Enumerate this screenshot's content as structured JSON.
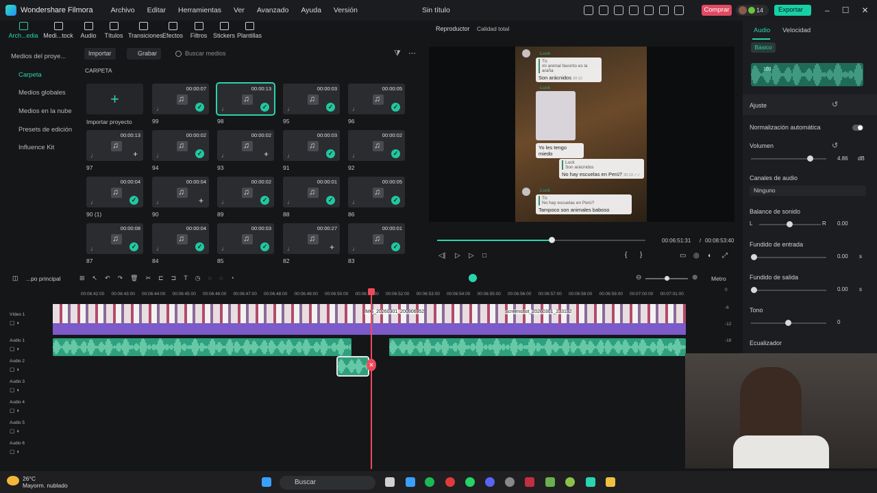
{
  "app": {
    "title": "Wonder­share Filmora",
    "window_title": "Sin título",
    "menu": [
      "Archivo",
      "Editar",
      "Herramientas",
      "Ver",
      "Avanzado",
      "Ayuda",
      "Versión"
    ],
    "buy": "Comprar",
    "export": "Exportar",
    "credits": "14"
  },
  "toolbar": [
    {
      "label": "Arch...edia",
      "icon": "folder-icon"
    },
    {
      "label": "Medi...tock",
      "icon": "stock-media-icon"
    },
    {
      "label": "Audio",
      "icon": "music-note-icon"
    },
    {
      "label": "Títulos",
      "icon": "text-icon"
    },
    {
      "label": "Transiciones",
      "icon": "transition-icon"
    },
    {
      "label": "Efectos",
      "icon": "effects-icon"
    },
    {
      "label": "Filtros",
      "icon": "filter-icon"
    },
    {
      "label": "Stickers",
      "icon": "sticker-icon"
    },
    {
      "label": "Plantillas",
      "icon": "template-icon"
    }
  ],
  "sidebar": {
    "items": [
      "Medios del proye...",
      "Carpeta",
      "Medios globales",
      "Medios en la nube",
      "Presets de edición",
      "Influence Kit"
    ]
  },
  "media": {
    "import_label": "Importar",
    "record_label": "Grabar",
    "search_placeholder": "Buscar medios",
    "folder": "CARPETA",
    "import_project": "Importar proyecto",
    "tiles": [
      {
        "name": "99",
        "dur": "00:00:07",
        "status": "check"
      },
      {
        "name": "98",
        "dur": "00:00:13",
        "status": "check"
      },
      {
        "name": "95",
        "dur": "00:00:03",
        "status": "check"
      },
      {
        "name": "96",
        "dur": "00:00:05",
        "status": "check"
      },
      {
        "name": "97",
        "dur": "00:00:13",
        "status": "add"
      },
      {
        "name": "94",
        "dur": "00:00:02",
        "status": "check"
      },
      {
        "name": "93",
        "dur": "00:00:02",
        "status": "add"
      },
      {
        "name": "91",
        "dur": "00:00:03",
        "status": "check"
      },
      {
        "name": "92",
        "dur": "00:00:02",
        "status": "check"
      },
      {
        "name": "90 (1)",
        "dur": "00:00:04",
        "status": "check"
      },
      {
        "name": "90",
        "dur": "00:00:04",
        "status": "add"
      },
      {
        "name": "89",
        "dur": "00:00:02",
        "status": "check"
      },
      {
        "name": "88",
        "dur": "00:00:01",
        "status": "check"
      },
      {
        "name": "86",
        "dur": "00:00:05",
        "status": "check"
      },
      {
        "name": "87",
        "dur": "00:00:08",
        "status": "check"
      },
      {
        "name": "84",
        "dur": "00:00:04",
        "status": "check"
      },
      {
        "name": "85",
        "dur": "00:00:03",
        "status": "check"
      },
      {
        "name": "82",
        "dur": "00:00:27",
        "status": "add"
      },
      {
        "name": "83",
        "dur": "00:00:01",
        "status": "check"
      }
    ]
  },
  "player": {
    "tab": "Reproductor",
    "quality": "Calidad total",
    "current": "00:06:51:31",
    "separator": "/",
    "total": "00:08:53:40",
    "progress": 0.55
  },
  "chat": {
    "name1": "Luck",
    "quote1_name": "Tú",
    "quote1_text": "mi animal favorito es la araña",
    "msg1": "Son arácnidos",
    "time1": "20:12",
    "name2": "Luck",
    "time2": "20:12",
    "msg2": "Yo les tengo miedo",
    "time3": "20:13",
    "quote2_name": "Luck",
    "quote2_text": "Son arácnidos",
    "msg3": "No hay escuelas en Perú?",
    "time4": "20:13 ✓✓",
    "name3": "Luck",
    "quote3_name": "Tú",
    "quote3_text": "No hay escuelas en Perú?",
    "msg4": "Tampoco son animales baboso",
    "time5": "20:13"
  },
  "right": {
    "tab_audio": "Audio",
    "tab_speed": "Velocidad",
    "basic": "Básico",
    "clip_num": "103",
    "adjust": "Ajuste",
    "autonorm": "Normalización automática",
    "volume": "Volumen",
    "volume_val": "4.86",
    "db": "dB",
    "channels": "Canales de audio",
    "channels_val": "Ninguno",
    "balance": "Balance de sonido",
    "L": "L",
    "R": "R",
    "balance_val": "0.00",
    "fadein": "Fundido de entrada",
    "fadein_val": "0.00",
    "s": "s",
    "fadeout": "Fundido  de salida",
    "fadeout_val": "0.00",
    "tone": "Tono",
    "tone_val": "0",
    "eq": "Ecualizador",
    "volume_level": 0.78
  },
  "timeline": {
    "seq": "...po principal",
    "meter": "Metro",
    "ruler": [
      "00:06:42:00",
      "00:06:43:00",
      "00:06:44:00",
      "00:06:45:00",
      "00:06:46:00",
      "00:06:47:00",
      "00:06:48:00",
      "00:06:49:00",
      "00:06:50:00",
      "00:06:51:00",
      "00:06:52:00",
      "00:06:53:00",
      "00:06:54:00",
      "00:06:55:00",
      "00:06:56:00",
      "00:06:57:00",
      "00:06:58:00",
      "00:06:59:00",
      "00:07:00:00",
      "00:07:01:00"
    ],
    "tracks": [
      "Vídeo 1",
      "Audio 1",
      "Audio 2",
      "Audio 3",
      "Audio 4",
      "Audio 5",
      "Audio 6"
    ],
    "clip_label1": "IMG_20260301_200906952",
    "clip_label2": "Screenshot_20260301_233192",
    "meter_ticks": [
      "0",
      "-6",
      "-12",
      "-18"
    ]
  },
  "taskbar": {
    "temp": "26°C",
    "weather": "Mayorm. nublado",
    "search": "Buscar"
  }
}
